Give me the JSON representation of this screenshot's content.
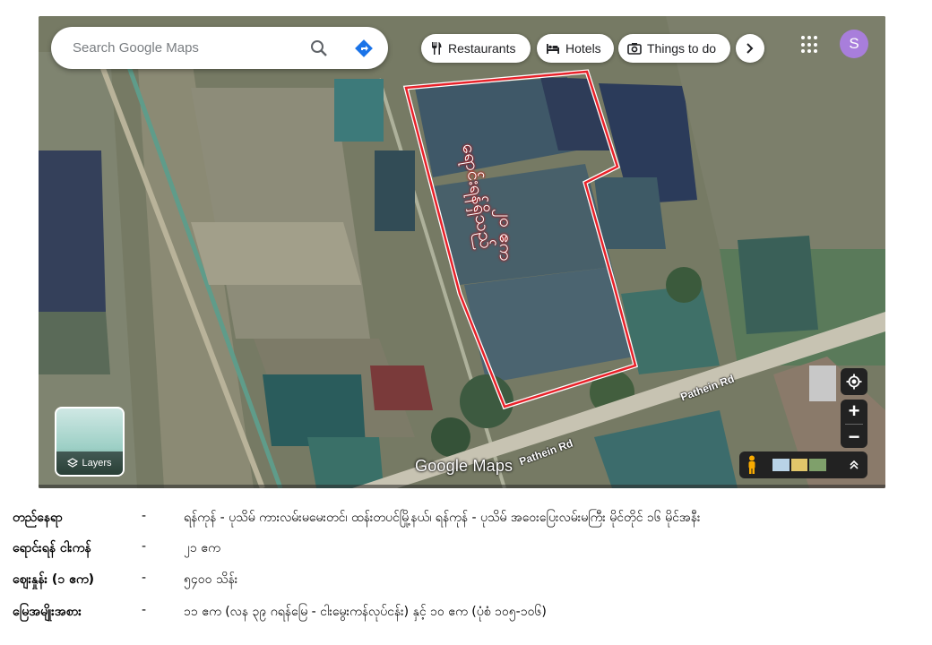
{
  "map": {
    "search": {
      "placeholder": "Search Google Maps"
    },
    "chips": [
      {
        "label": "Restaurants",
        "icon": "fork-knife-icon"
      },
      {
        "label": "Hotels",
        "icon": "bed-icon"
      },
      {
        "label": "Things to do",
        "icon": "camera-icon"
      }
    ],
    "account_initial": "S",
    "layers_label": "Layers",
    "logo": "Google Maps",
    "roads": [
      "Pathein Rd",
      "Pathein Rd"
    ],
    "parcel_label_1": "၂၀ ဧက",
    "parcel_label_2": "ရောင်းရန်ရှိသည်",
    "colors": {
      "boundary": "#e8222a",
      "avatar": "#a87edb",
      "directions": "#1a73e8"
    }
  },
  "info": [
    {
      "key": "တည်နေရာ",
      "dash": "-",
      "value": "ရန်ကုန် - ပုသိမ် ကားလမ်းမမေးတင်၊ ထန်းတပင်မြို့နယ်၊ ရန်ကုန် - ပုသိမ် အဝေးပြေးလမ်းမကြီး မိုင်တိုင် ၁၆ မိုင်အနီး"
    },
    {
      "key": "ရောင်းရန် ငါးကန်",
      "dash": "-",
      "value": "၂၁ ဧက"
    },
    {
      "key": "ဈေးနှုန်း (၁ ဧက)",
      "dash": "-",
      "value": "၅၄၀၀ သိန်း"
    },
    {
      "key": "မြေအမျိုးအစား",
      "dash": "-",
      "value": "၁၁ ဧက (လန ၃၉ ဂရန်မြေ - ငါးမွေးကန်လုပ်ငန်း) နှင့် ၁၀ ဧက (ပုံစံ ၁၀၅-၁၀၆)"
    }
  ]
}
